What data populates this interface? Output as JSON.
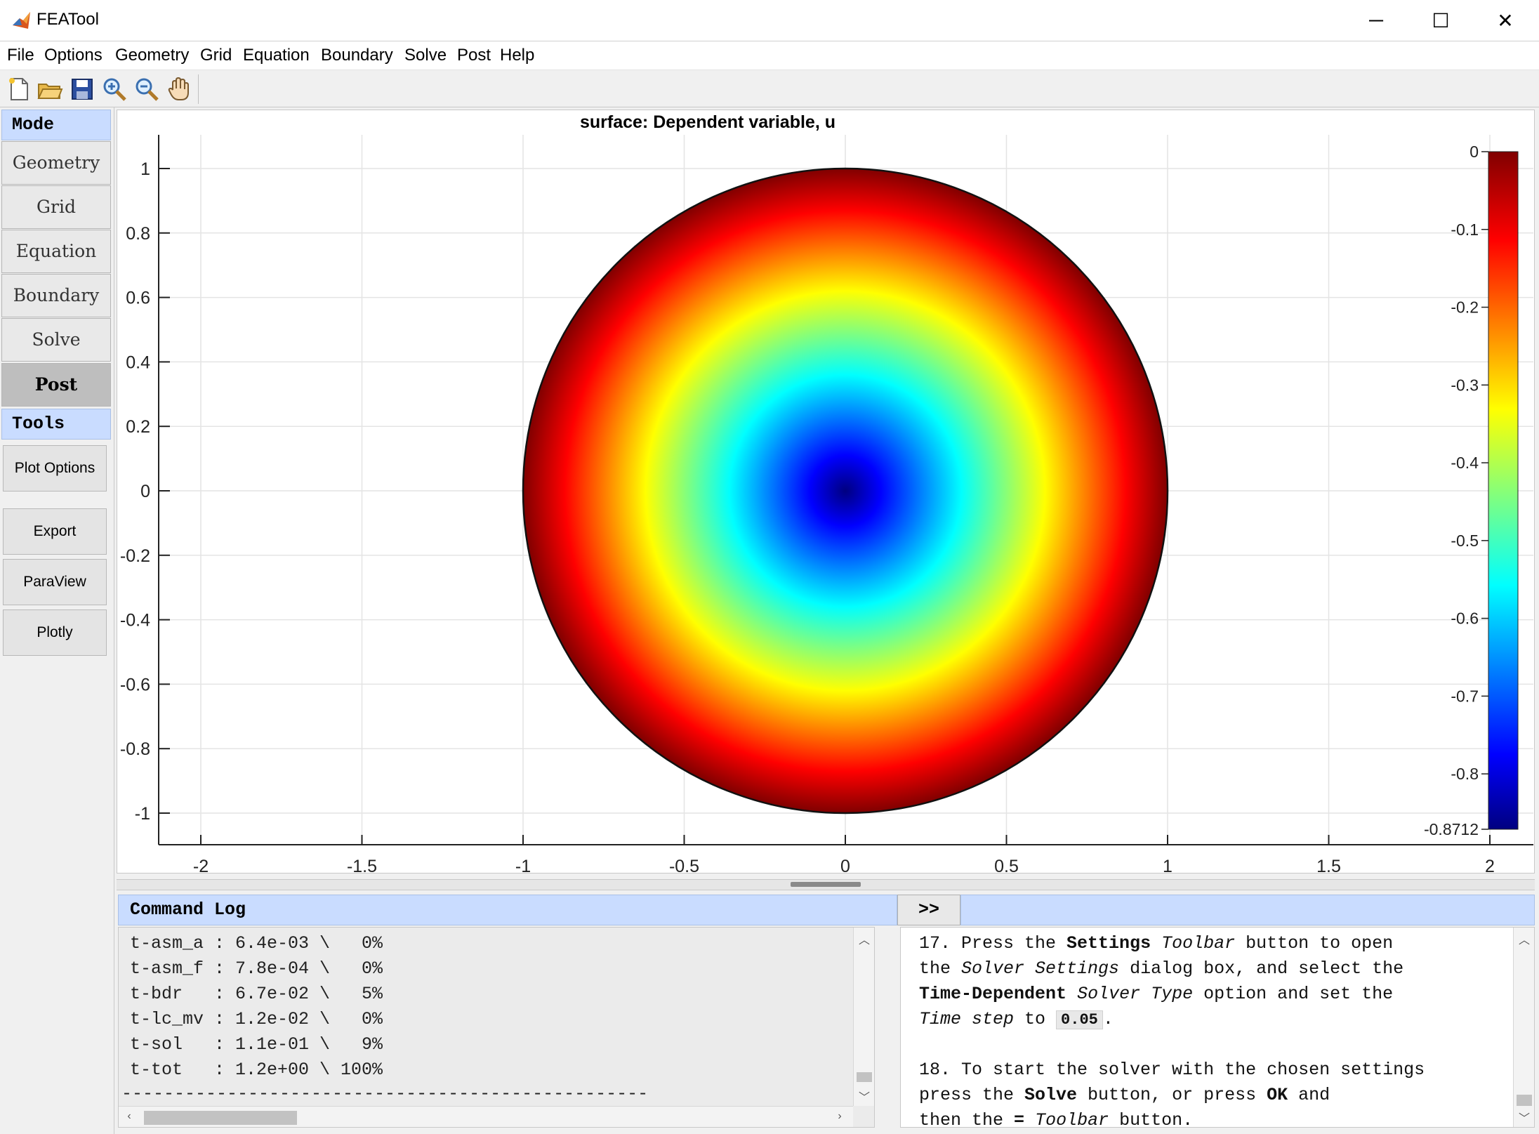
{
  "window": {
    "title": "FEATool",
    "minimize_symbol": "─",
    "maximize_symbol": "☐",
    "close_symbol": "✕"
  },
  "menu": [
    "File",
    "Options",
    "Geometry",
    "Grid",
    "Equation",
    "Boundary",
    "Solve",
    "Post",
    "Help"
  ],
  "toolbar": {
    "icons": [
      "new-file-icon",
      "open-folder-icon",
      "save-icon",
      "zoom-in-icon",
      "zoom-out-icon",
      "pan-hand-icon"
    ]
  },
  "sidebar": {
    "mode_header": "Mode",
    "modes": [
      "Geometry",
      "Grid",
      "Equation",
      "Boundary",
      "Solve",
      "Post"
    ],
    "active_mode": "Post",
    "tools_header": "Tools",
    "tools": [
      "Plot Options",
      "Export",
      "ParaView",
      "Plotly"
    ]
  },
  "chart_data": {
    "type": "heatmap",
    "title": "surface: Dependent variable, u",
    "description_shape": "disk",
    "xlim": [
      -2.1,
      2.0
    ],
    "ylim": [
      -1.1,
      1.1
    ],
    "x_ticks": [
      "-2",
      "-1.5",
      "-1",
      "-0.5",
      "0",
      "0.5",
      "1",
      "1.5",
      "2"
    ],
    "y_ticks": [
      "1",
      "0.8",
      "0.6",
      "0.4",
      "0.2",
      "0",
      "-0.2",
      "-0.4",
      "-0.6",
      "-0.8",
      "-1"
    ],
    "grid": true,
    "colormap": "jet",
    "colorbar": {
      "min": -0.8712,
      "max": 0,
      "ticks": [
        "0",
        "-0.1",
        "-0.2",
        "-0.3",
        "-0.4",
        "-0.5",
        "-0.6",
        "-0.7",
        "-0.8",
        "-0.8712"
      ]
    },
    "field": {
      "center": [
        0,
        0
      ],
      "radius": 1,
      "value_at_center": -0.8712,
      "value_at_boundary": 0
    }
  },
  "command_log": {
    "header": "Command Log",
    "lines": [
      "t-asm_a : 6.4e-03 \\   0%",
      "t-asm_f : 7.8e-04 \\   0%",
      "t-bdr   : 6.7e-02 \\   5%",
      "t-lc_mv : 1.2e-02 \\   0%",
      "t-sol   : 1.1e-01 \\   9%",
      "t-tot   : 1.2e+00 \\ 100%",
      "--------------------------------------------------"
    ]
  },
  "expand_button": ">>",
  "help": {
    "step17": {
      "a": "17. Press the ",
      "b": "Settings",
      "c": "Toolbar",
      "d": " button to open",
      "e": "the ",
      "f": "Solver Settings",
      "g": " dialog box, and select the",
      "h": "Time-Dependent",
      "i": "Solver Type",
      "j": " option and set the",
      "k": "Time step",
      "l": " to ",
      "m": "0.05",
      "n": "."
    },
    "step18": {
      "a": "18. To start the solver with the chosen settings",
      "b": "press the ",
      "c": "Solve",
      "d": " button, or press ",
      "e": "OK",
      "f": " and",
      "g": "then the ",
      "h": "=",
      "i": "Toolbar",
      "j": " button."
    }
  }
}
